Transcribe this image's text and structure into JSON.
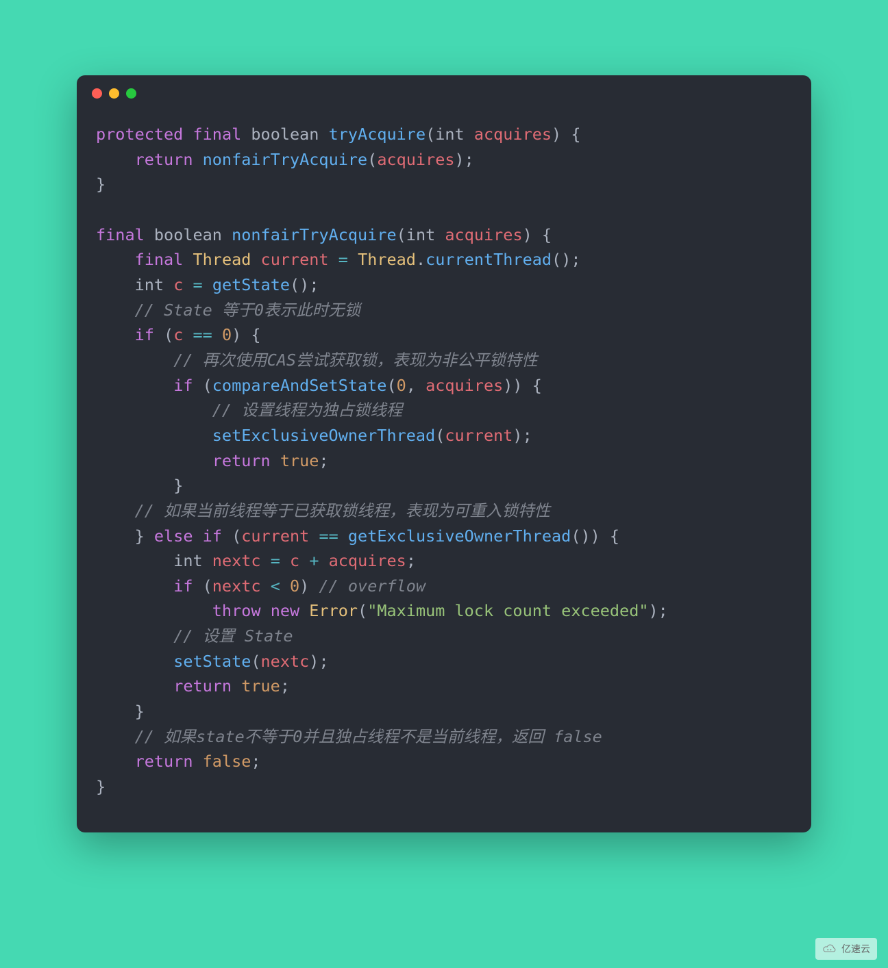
{
  "watermark": {
    "text": "亿速云"
  },
  "code": {
    "tokens": [
      {
        "t": "protected",
        "c": "kw"
      },
      {
        "t": " ",
        "c": "pn"
      },
      {
        "t": "final",
        "c": "kw"
      },
      {
        "t": " ",
        "c": "pn"
      },
      {
        "t": "boolean",
        "c": "type"
      },
      {
        "t": " ",
        "c": "pn"
      },
      {
        "t": "tryAcquire",
        "c": "fn"
      },
      {
        "t": "(",
        "c": "pn"
      },
      {
        "t": "int",
        "c": "type"
      },
      {
        "t": " ",
        "c": "pn"
      },
      {
        "t": "acquires",
        "c": "var"
      },
      {
        "t": ")",
        "c": "pn"
      },
      {
        "t": " {",
        "c": "pn"
      },
      {
        "t": "\n",
        "c": "pn"
      },
      {
        "t": "    ",
        "c": "pn"
      },
      {
        "t": "return",
        "c": "kw"
      },
      {
        "t": " ",
        "c": "pn"
      },
      {
        "t": "nonfairTryAcquire",
        "c": "fn"
      },
      {
        "t": "(",
        "c": "pn"
      },
      {
        "t": "acquires",
        "c": "var"
      },
      {
        "t": ")",
        "c": "pn"
      },
      {
        "t": ";",
        "c": "pn"
      },
      {
        "t": "\n",
        "c": "pn"
      },
      {
        "t": "}",
        "c": "pn"
      },
      {
        "t": "\n",
        "c": "pn"
      },
      {
        "t": "\n",
        "c": "pn"
      },
      {
        "t": "final",
        "c": "kw"
      },
      {
        "t": " ",
        "c": "pn"
      },
      {
        "t": "boolean",
        "c": "type"
      },
      {
        "t": " ",
        "c": "pn"
      },
      {
        "t": "nonfairTryAcquire",
        "c": "fn"
      },
      {
        "t": "(",
        "c": "pn"
      },
      {
        "t": "int",
        "c": "type"
      },
      {
        "t": " ",
        "c": "pn"
      },
      {
        "t": "acquires",
        "c": "var"
      },
      {
        "t": ")",
        "c": "pn"
      },
      {
        "t": " {",
        "c": "pn"
      },
      {
        "t": "\n",
        "c": "pn"
      },
      {
        "t": "    ",
        "c": "pn"
      },
      {
        "t": "final",
        "c": "kw"
      },
      {
        "t": " ",
        "c": "pn"
      },
      {
        "t": "Thread",
        "c": "err"
      },
      {
        "t": " ",
        "c": "pn"
      },
      {
        "t": "current",
        "c": "var"
      },
      {
        "t": " ",
        "c": "pn"
      },
      {
        "t": "=",
        "c": "op"
      },
      {
        "t": " ",
        "c": "pn"
      },
      {
        "t": "Thread",
        "c": "err"
      },
      {
        "t": ".",
        "c": "pn"
      },
      {
        "t": "currentThread",
        "c": "fn"
      },
      {
        "t": "()",
        "c": "pn"
      },
      {
        "t": ";",
        "c": "pn"
      },
      {
        "t": "\n",
        "c": "pn"
      },
      {
        "t": "    ",
        "c": "pn"
      },
      {
        "t": "int",
        "c": "type"
      },
      {
        "t": " ",
        "c": "pn"
      },
      {
        "t": "c",
        "c": "var"
      },
      {
        "t": " ",
        "c": "pn"
      },
      {
        "t": "=",
        "c": "op"
      },
      {
        "t": " ",
        "c": "pn"
      },
      {
        "t": "getState",
        "c": "fn"
      },
      {
        "t": "()",
        "c": "pn"
      },
      {
        "t": ";",
        "c": "pn"
      },
      {
        "t": "\n",
        "c": "pn"
      },
      {
        "t": "    ",
        "c": "pn"
      },
      {
        "t": "// State 等于0表示此时无锁",
        "c": "cmt"
      },
      {
        "t": "\n",
        "c": "pn"
      },
      {
        "t": "    ",
        "c": "pn"
      },
      {
        "t": "if",
        "c": "kw"
      },
      {
        "t": " (",
        "c": "pn"
      },
      {
        "t": "c",
        "c": "var"
      },
      {
        "t": " ",
        "c": "pn"
      },
      {
        "t": "==",
        "c": "op"
      },
      {
        "t": " ",
        "c": "pn"
      },
      {
        "t": "0",
        "c": "num"
      },
      {
        "t": ")",
        "c": "pn"
      },
      {
        "t": " {",
        "c": "pn"
      },
      {
        "t": "\n",
        "c": "pn"
      },
      {
        "t": "        ",
        "c": "pn"
      },
      {
        "t": "// 再次使用CAS尝试获取锁，表现为非公平锁特性",
        "c": "cmt"
      },
      {
        "t": "\n",
        "c": "pn"
      },
      {
        "t": "        ",
        "c": "pn"
      },
      {
        "t": "if",
        "c": "kw"
      },
      {
        "t": " (",
        "c": "pn"
      },
      {
        "t": "compareAndSetState",
        "c": "fn"
      },
      {
        "t": "(",
        "c": "pn"
      },
      {
        "t": "0",
        "c": "num"
      },
      {
        "t": ",",
        "c": "pn"
      },
      {
        "t": " ",
        "c": "pn"
      },
      {
        "t": "acquires",
        "c": "var"
      },
      {
        "t": "))",
        "c": "pn"
      },
      {
        "t": " {",
        "c": "pn"
      },
      {
        "t": "\n",
        "c": "pn"
      },
      {
        "t": "            ",
        "c": "pn"
      },
      {
        "t": "// 设置线程为独占锁线程",
        "c": "cmt"
      },
      {
        "t": "\n",
        "c": "pn"
      },
      {
        "t": "            ",
        "c": "pn"
      },
      {
        "t": "setExclusiveOwnerThread",
        "c": "fn"
      },
      {
        "t": "(",
        "c": "pn"
      },
      {
        "t": "current",
        "c": "var"
      },
      {
        "t": ")",
        "c": "pn"
      },
      {
        "t": ";",
        "c": "pn"
      },
      {
        "t": "\n",
        "c": "pn"
      },
      {
        "t": "            ",
        "c": "pn"
      },
      {
        "t": "return",
        "c": "kw"
      },
      {
        "t": " ",
        "c": "pn"
      },
      {
        "t": "true",
        "c": "num"
      },
      {
        "t": ";",
        "c": "pn"
      },
      {
        "t": "\n",
        "c": "pn"
      },
      {
        "t": "        ",
        "c": "pn"
      },
      {
        "t": "}",
        "c": "pn"
      },
      {
        "t": "\n",
        "c": "pn"
      },
      {
        "t": "    ",
        "c": "pn"
      },
      {
        "t": "// 如果当前线程等于已获取锁线程，表现为可重入锁特性",
        "c": "cmt"
      },
      {
        "t": "\n",
        "c": "pn"
      },
      {
        "t": "    ",
        "c": "pn"
      },
      {
        "t": "}",
        "c": "pn"
      },
      {
        "t": " ",
        "c": "pn"
      },
      {
        "t": "else",
        "c": "kw"
      },
      {
        "t": " ",
        "c": "pn"
      },
      {
        "t": "if",
        "c": "kw"
      },
      {
        "t": " (",
        "c": "pn"
      },
      {
        "t": "current",
        "c": "var"
      },
      {
        "t": " ",
        "c": "pn"
      },
      {
        "t": "==",
        "c": "op"
      },
      {
        "t": " ",
        "c": "pn"
      },
      {
        "t": "getExclusiveOwnerThread",
        "c": "fn"
      },
      {
        "t": "())",
        "c": "pn"
      },
      {
        "t": " {",
        "c": "pn"
      },
      {
        "t": "\n",
        "c": "pn"
      },
      {
        "t": "        ",
        "c": "pn"
      },
      {
        "t": "int",
        "c": "type"
      },
      {
        "t": " ",
        "c": "pn"
      },
      {
        "t": "nextc",
        "c": "var"
      },
      {
        "t": " ",
        "c": "pn"
      },
      {
        "t": "=",
        "c": "op"
      },
      {
        "t": " ",
        "c": "pn"
      },
      {
        "t": "c",
        "c": "var"
      },
      {
        "t": " ",
        "c": "pn"
      },
      {
        "t": "+",
        "c": "op"
      },
      {
        "t": " ",
        "c": "pn"
      },
      {
        "t": "acquires",
        "c": "var"
      },
      {
        "t": ";",
        "c": "pn"
      },
      {
        "t": "\n",
        "c": "pn"
      },
      {
        "t": "        ",
        "c": "pn"
      },
      {
        "t": "if",
        "c": "kw"
      },
      {
        "t": " (",
        "c": "pn"
      },
      {
        "t": "nextc",
        "c": "var"
      },
      {
        "t": " ",
        "c": "pn"
      },
      {
        "t": "<",
        "c": "op"
      },
      {
        "t": " ",
        "c": "pn"
      },
      {
        "t": "0",
        "c": "num"
      },
      {
        "t": ")",
        "c": "pn"
      },
      {
        "t": " ",
        "c": "pn"
      },
      {
        "t": "// overflow",
        "c": "cmt"
      },
      {
        "t": "\n",
        "c": "pn"
      },
      {
        "t": "            ",
        "c": "pn"
      },
      {
        "t": "throw",
        "c": "kw"
      },
      {
        "t": " ",
        "c": "pn"
      },
      {
        "t": "new",
        "c": "kw"
      },
      {
        "t": " ",
        "c": "pn"
      },
      {
        "t": "Error",
        "c": "err"
      },
      {
        "t": "(",
        "c": "pn"
      },
      {
        "t": "\"Maximum lock count exceeded\"",
        "c": "str"
      },
      {
        "t": ")",
        "c": "pn"
      },
      {
        "t": ";",
        "c": "pn"
      },
      {
        "t": "\n",
        "c": "pn"
      },
      {
        "t": "        ",
        "c": "pn"
      },
      {
        "t": "// 设置 State",
        "c": "cmt"
      },
      {
        "t": "\n",
        "c": "pn"
      },
      {
        "t": "        ",
        "c": "pn"
      },
      {
        "t": "setState",
        "c": "fn"
      },
      {
        "t": "(",
        "c": "pn"
      },
      {
        "t": "nextc",
        "c": "var"
      },
      {
        "t": ")",
        "c": "pn"
      },
      {
        "t": ";",
        "c": "pn"
      },
      {
        "t": "\n",
        "c": "pn"
      },
      {
        "t": "        ",
        "c": "pn"
      },
      {
        "t": "return",
        "c": "kw"
      },
      {
        "t": " ",
        "c": "pn"
      },
      {
        "t": "true",
        "c": "num"
      },
      {
        "t": ";",
        "c": "pn"
      },
      {
        "t": "\n",
        "c": "pn"
      },
      {
        "t": "    ",
        "c": "pn"
      },
      {
        "t": "}",
        "c": "pn"
      },
      {
        "t": "\n",
        "c": "pn"
      },
      {
        "t": "    ",
        "c": "pn"
      },
      {
        "t": "// 如果state不等于0并且独占线程不是当前线程，返回 false",
        "c": "cmt"
      },
      {
        "t": "\n",
        "c": "pn"
      },
      {
        "t": "    ",
        "c": "pn"
      },
      {
        "t": "return",
        "c": "kw"
      },
      {
        "t": " ",
        "c": "pn"
      },
      {
        "t": "false",
        "c": "num"
      },
      {
        "t": ";",
        "c": "pn"
      },
      {
        "t": "\n",
        "c": "pn"
      },
      {
        "t": "}",
        "c": "pn"
      }
    ]
  }
}
